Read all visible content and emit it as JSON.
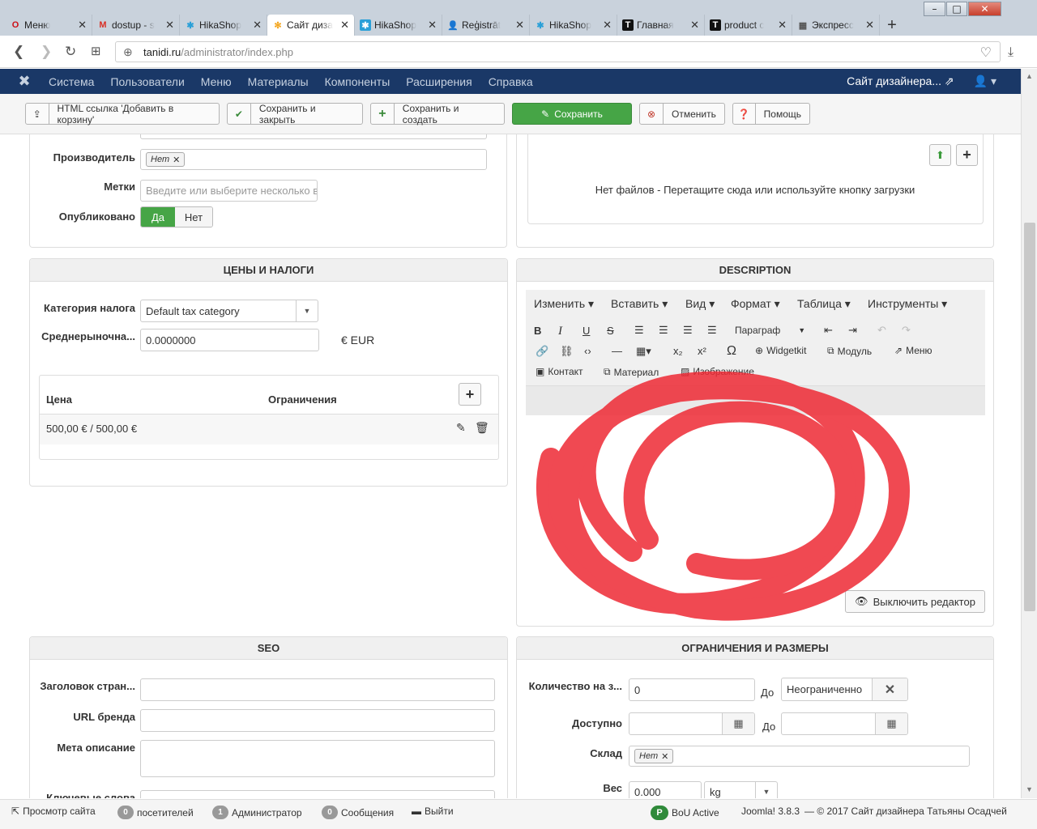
{
  "browser": {
    "window_controls": {
      "minimize": "–",
      "maximize": "□",
      "close": "✕"
    },
    "tabs": [
      {
        "label": "Меню",
        "icon": "opera-icon",
        "glyph": "O",
        "color": "#cc0f16"
      },
      {
        "label": "dostup - s",
        "icon": "gmail-icon",
        "glyph": "M",
        "color": "#d93025"
      },
      {
        "label": "HikaShop",
        "icon": "hikashop-icon",
        "glyph": "✱",
        "color": "#2aa0d8"
      },
      {
        "label": "Сайт диза",
        "icon": "joomla-icon",
        "glyph": "✻",
        "color": "#f4a41a"
      },
      {
        "label": "HikaShop",
        "icon": "hikashop-icon",
        "glyph": "✱",
        "color": "#ffffff"
      },
      {
        "label": "Reģistrāt",
        "icon": "user-icon",
        "glyph": "👤",
        "color": "#4a70b8"
      },
      {
        "label": "HikaShop",
        "icon": "hikashop-icon",
        "glyph": "✱",
        "color": "#2aa0d8"
      },
      {
        "label": "Главная",
        "icon": "t-icon",
        "glyph": "T",
        "color": "#ffffff"
      },
      {
        "label": "product c",
        "icon": "t-icon",
        "glyph": "T",
        "color": "#ffffff"
      },
      {
        "label": "Экспресс",
        "icon": "grid-icon",
        "glyph": "▦",
        "color": "#555555"
      }
    ],
    "new_tab": "+",
    "url_host": "tanidi.ru",
    "url_path": "/administrator/index.php"
  },
  "joomla_nav": {
    "logo": "✖",
    "items": [
      "Система",
      "Пользователи",
      "Меню",
      "Материалы",
      "Компоненты",
      "Расширения",
      "Справка"
    ],
    "site_link": "Сайт дизайнера... ⇗",
    "user": "👤 ▾"
  },
  "toolbar": {
    "html_link": "HTML ссылка 'Добавить в корзину'",
    "save_close": "Сохранить и закрыть",
    "save_new": "Сохранить и создать",
    "save": "Сохранить",
    "cancel": "Отменить",
    "help": "Помощь"
  },
  "details": {
    "manufacturer_label": "Производитель",
    "manufacturer_chip": "Нет",
    "tags_label": "Метки",
    "tags_placeholder": "Введите или выберите несколько в",
    "published_label": "Опубликовано",
    "yes": "Да",
    "no": "Нет"
  },
  "files": {
    "empty_text": "Нет файлов - Перетащите сюда или используйте кнопку загрузки"
  },
  "prices": {
    "title": "ЦЕНЫ И НАЛОГИ",
    "tax_label": "Категория налога",
    "tax_value": "Default tax category",
    "avg_label": "Среднерыночна...",
    "avg_value": "0.0000000",
    "currency": "€ EUR",
    "col_price": "Цена",
    "col_restrictions": "Ограничения",
    "row_price": "500,00 € / 500,00 €"
  },
  "description": {
    "title": "DESCRIPTION",
    "menu": [
      "Изменить ▾",
      "Вставить ▾",
      "Вид ▾",
      "Формат ▾",
      "Таблица ▾",
      "Инструменты ▾"
    ],
    "paragraph": "Параграф",
    "widgetkit": "Widgetkit",
    "module": "Модуль",
    "menu_btn": "Меню",
    "contact": "Контакт",
    "article": "Материал",
    "image": "Изображение",
    "toggle_editor": "Выключить редактор"
  },
  "seo": {
    "title": "SEO",
    "page_title_label": "Заголовок стран...",
    "brand_url_label": "URL бренда",
    "meta_desc_label": "Мета описание",
    "keywords_label": "Ключевые слова"
  },
  "limits": {
    "title": "ОГРАНИЧЕНИЯ И РАЗМЕРЫ",
    "qty_label": "Количество на з...",
    "qty_value": "0",
    "to": "До",
    "unlimited": "Неограниченно",
    "available_label": "Доступно",
    "warehouse_label": "Склад",
    "warehouse_chip": "Нет",
    "weight_label": "Вес",
    "weight_value": "0.000",
    "weight_unit": "kg"
  },
  "statusbar": {
    "view_site": "Просмотр сайта",
    "visitors_count": "0",
    "visitors": "посетителей",
    "admins_count": "1",
    "admins": "Администратор",
    "messages_count": "0",
    "messages": "Сообщения",
    "logout": "Выйти",
    "bou": "BoU Active",
    "version": "Joomla! 3.8.3",
    "copyright": "— © 2017 Сайт дизайнера Татьяны Осадчей"
  },
  "colors": {
    "nav_bg": "#1a3867",
    "save_green": "#46a546",
    "scribble_red": "#ee2a35"
  }
}
